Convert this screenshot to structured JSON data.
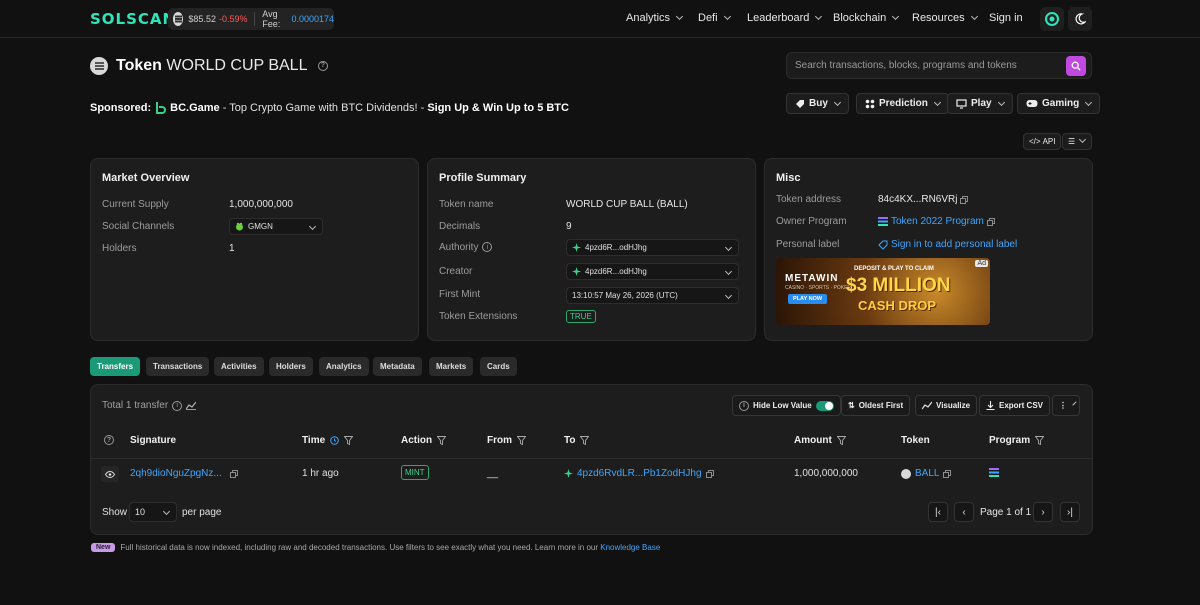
{
  "header": {
    "logo": "SOLSCAN",
    "sol_price": "$85.52",
    "sol_change": "-0.59%",
    "fee_label": "Avg Fee:",
    "fee_value": "0.0000174",
    "nav": [
      "Analytics",
      "Defi",
      "Leaderboard",
      "Blockchain",
      "Resources"
    ],
    "signin": "Sign in"
  },
  "token": {
    "prefix": "Token",
    "name": "WORLD CUP BALL"
  },
  "search": {
    "placeholder": "Search transactions, blocks, programs and tokens"
  },
  "sponsor": {
    "label": "Sponsored:",
    "brand": "BC.Game",
    "text": " - Top Crypto Game with BTC Dividends! - ",
    "cta": "Sign Up & Win Up to 5 BTC"
  },
  "actions": {
    "buy": "Buy",
    "prediction": "Prediction",
    "play": "Play",
    "gaming": "Gaming",
    "api": "API"
  },
  "market": {
    "title": "Market Overview",
    "supply_label": "Current Supply",
    "supply_value": "1,000,000,000",
    "social_label": "Social Channels",
    "social_value": "GMGN",
    "holders_label": "Holders",
    "holders_value": "1"
  },
  "profile": {
    "title": "Profile Summary",
    "name_label": "Token name",
    "name_value": "WORLD CUP BALL (BALL)",
    "decimals_label": "Decimals",
    "decimals_value": "9",
    "authority_label": "Authority",
    "authority_value": "4pzd6R...odHJhg",
    "creator_label": "Creator",
    "creator_value": "4pzd6R...odHJhg",
    "mint_label": "First Mint",
    "mint_value": "13:10:57 May 26, 2026 (UTC)",
    "ext_label": "Token Extensions",
    "ext_value": "TRUE"
  },
  "misc": {
    "title": "Misc",
    "address_label": "Token address",
    "address_value": "84c4KX...RN6VRj",
    "owner_label": "Owner Program",
    "owner_value": "Token 2022 Program",
    "personal_label": "Personal label",
    "personal_value": "Sign in to add personal label",
    "ad": {
      "tag": "Ad",
      "brand": "METAWIN",
      "brand_sub": "CASINO · SPORTS · POKER",
      "play": "PLAY NOW",
      "line1": "DEPOSIT & PLAY TO CLAIM",
      "line2": "$3 MILLION",
      "line3": "CASH DROP"
    }
  },
  "tabs": [
    "Transfers",
    "Transactions",
    "Activities",
    "Holders",
    "Analytics",
    "Metadata",
    "Markets",
    "Cards"
  ],
  "transfers": {
    "total": "Total 1 transfer",
    "hide_low": "Hide Low Value",
    "oldest": "Oldest First",
    "visualize": "Visualize",
    "export": "Export CSV",
    "columns": [
      "Signature",
      "Time",
      "Action",
      "From",
      "To",
      "Amount",
      "Token",
      "Program"
    ],
    "row": {
      "signature": "2qh9dioNguZpgNz...",
      "time": "1 hr ago",
      "action": "MINT",
      "from": "__",
      "to": "4pzd6RvdLR...Pb1ZodHJhg",
      "amount": "1,000,000,000",
      "token": "BALL"
    },
    "show_label": "Show",
    "per_page_value": "10",
    "per_page_label": "per page",
    "page_text": "Page 1 of 1"
  },
  "footer": {
    "badge": "New",
    "text": "Full historical data is now indexed, including raw and decoded transactions. Use filters to see exactly what you need. Learn more in our ",
    "link": "Knowledge Base"
  },
  "colors": {
    "accent": "#1b9a78",
    "link": "#3ea6ff",
    "negative": "#ff5a5a",
    "search_button": "#c04ae0"
  }
}
